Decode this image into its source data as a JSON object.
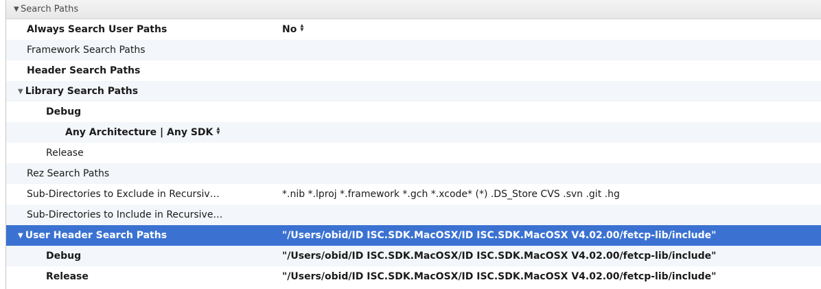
{
  "group": {
    "title": "Search Paths"
  },
  "rows": [
    {
      "label": "Always Search User Paths",
      "value": "No"
    },
    {
      "label": "Framework Search Paths",
      "value": ""
    },
    {
      "label": "Header Search Paths",
      "value": ""
    },
    {
      "label": "Library Search Paths",
      "value": ""
    },
    {
      "label": "Debug",
      "value": ""
    },
    {
      "label": "Any Architecture | Any SDK",
      "value": ""
    },
    {
      "label": "Release",
      "value": ""
    },
    {
      "label": "Rez Search Paths",
      "value": ""
    },
    {
      "label": "Sub-Directories to Exclude in Recursiv…",
      "value": "*.nib *.lproj *.framework *.gch *.xcode* (*) .DS_Store CVS .svn .git .hg"
    },
    {
      "label": "Sub-Directories to Include in Recursive…",
      "value": ""
    },
    {
      "label": "User Header Search Paths",
      "value": "\"/Users/obid/ID ISC.SDK.MacOSX/ID ISC.SDK.MacOSX V4.02.00/fetcp-lib/include\""
    },
    {
      "label": "Debug",
      "value": "\"/Users/obid/ID ISC.SDK.MacOSX/ID ISC.SDK.MacOSX V4.02.00/fetcp-lib/include\""
    },
    {
      "label": "Release",
      "value": "\"/Users/obid/ID ISC.SDK.MacOSX/ID ISC.SDK.MacOSX V4.02.00/fetcp-lib/include\""
    }
  ],
  "icons": {
    "disclosure": "disclosure-triangle-icon",
    "stepper": "up-down-stepper-icon"
  },
  "colors": {
    "selection": "#3b72d2",
    "alt_row": "#f3f6fa",
    "header_bg": "#ececec"
  }
}
